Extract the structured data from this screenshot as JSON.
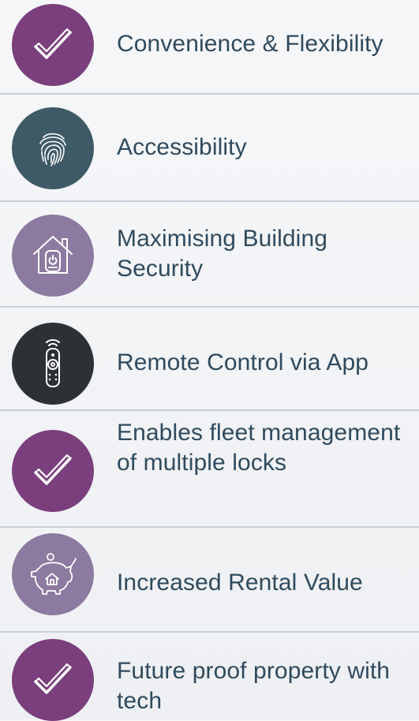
{
  "colors": {
    "purple": "#7b3f7d",
    "slate": "#3e5a66",
    "lavender": "#8c7aa0",
    "charcoal": "#2d3136",
    "text": "#2f4a5e",
    "divider": "#c9cfd8"
  },
  "items": [
    {
      "label": "Convenience & Flexibility",
      "icon": "check-icon",
      "color": "#7b3f7d"
    },
    {
      "label": "Accessibility",
      "icon": "fingerprint-icon",
      "color": "#3e5a66"
    },
    {
      "label": "Maximising Building Security",
      "icon": "smart-home-icon",
      "color": "#8c7aa0"
    },
    {
      "label": "Remote Control via App",
      "icon": "remote-control-icon",
      "color": "#2d3136"
    },
    {
      "label": "Enables fleet management of multiple locks",
      "icon": "check-icon",
      "color": "#7b3f7d"
    },
    {
      "label": "Increased Rental Value",
      "icon": "piggy-bank-icon",
      "color": "#8c7aa0"
    },
    {
      "label": "Future proof property with tech",
      "icon": "check-icon",
      "color": "#7b3f7d"
    }
  ]
}
